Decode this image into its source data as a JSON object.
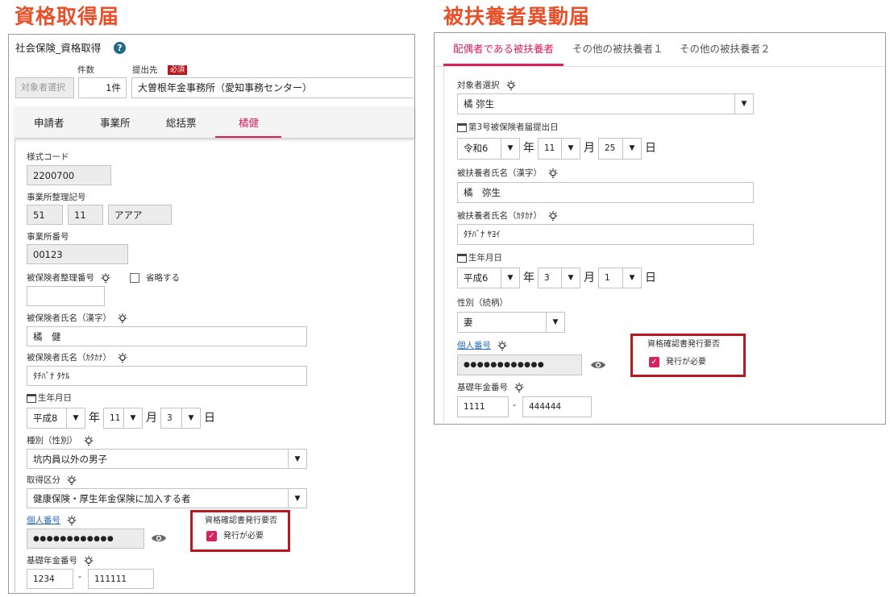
{
  "left": {
    "title": "資格取得届",
    "form_name": "社会保険_資格取得",
    "help_icon": "?",
    "count_label": "件数",
    "dest_label": "提出先",
    "required_badge": "必須",
    "select_target_button": "対象者選択",
    "count_value": "1件",
    "dest_value": "大曽根年金事務所（愛知事務センター）",
    "tabs": [
      "申請者",
      "事業所",
      "総括票",
      "橘健"
    ],
    "fields": {
      "form_code_label": "様式コード",
      "form_code_value": "2200700",
      "office_mgmt_label": "事業所整理記号",
      "office_mgmt_values": [
        "51",
        "11",
        "アアア"
      ],
      "office_no_label": "事業所番号",
      "office_no_value": "00123",
      "insured_no_label": "被保険者整理番号",
      "omit_label": "省略する",
      "name_kanji_label": "被保険者氏名（漢字）",
      "name_kanji_value": "橘　健",
      "name_kana_label": "被保険者氏名（ｶﾀｶﾅ）",
      "name_kana_value": "ﾀﾁﾊﾞﾅ ﾀｹﾙ",
      "birth_label": "生年月日",
      "birth_era": "平成8",
      "birth_month": "11",
      "birth_day": "3",
      "unit_year": "年",
      "unit_month": "月",
      "unit_day": "日",
      "gender_label": "種別（性別）",
      "gender_value": "坑内員以外の男子",
      "acq_label": "取得区分",
      "acq_value": "健康保険・厚生年金保険に加入する者",
      "mynumber_label": "個人番号",
      "mynumber_value": "●●●●●●●●●●●●",
      "cert_label": "資格確認書発行要否",
      "cert_option": "発行が必要",
      "pension_label": "基礎年金番号",
      "pension_a": "1234",
      "pension_dash": "-",
      "pension_b": "111111"
    }
  },
  "right": {
    "title": "被扶養者異動届",
    "tabs": [
      "配偶者である被扶養者",
      "その他の被扶養者１",
      "その他の被扶養者２"
    ],
    "fields": {
      "target_label": "対象者選択",
      "target_value": "橘 弥生",
      "submit_label": "第3号被保険者届提出日",
      "submit_era": "令和6",
      "submit_month": "11",
      "submit_day": "25",
      "unit_year": "年",
      "unit_month": "月",
      "unit_day": "日",
      "name_kanji_label": "被扶養者氏名（漢字）",
      "name_kanji_value": "橘　弥生",
      "name_kana_label": "被扶養者氏名（ｶﾀｶﾅ）",
      "name_kana_value": "ﾀﾁﾊﾞﾅ ﾔﾖｲ",
      "birth_label": "生年月日",
      "birth_era": "平成6",
      "birth_month": "3",
      "birth_day": "1",
      "relation_label": "性別（続柄）",
      "relation_value": "妻",
      "mynumber_label": "個人番号",
      "mynumber_value": "●●●●●●●●●●●●",
      "cert_label": "資格確認書発行要否",
      "cert_option": "発行が必要",
      "pension_label": "基礎年金番号",
      "pension_a": "1111",
      "pension_dash": "-",
      "pension_b": "444444"
    }
  },
  "colors": {
    "title": "#e8502a",
    "accent": "#d6225f",
    "highlight_border": "#b8191e",
    "link": "#2a6ab8"
  }
}
